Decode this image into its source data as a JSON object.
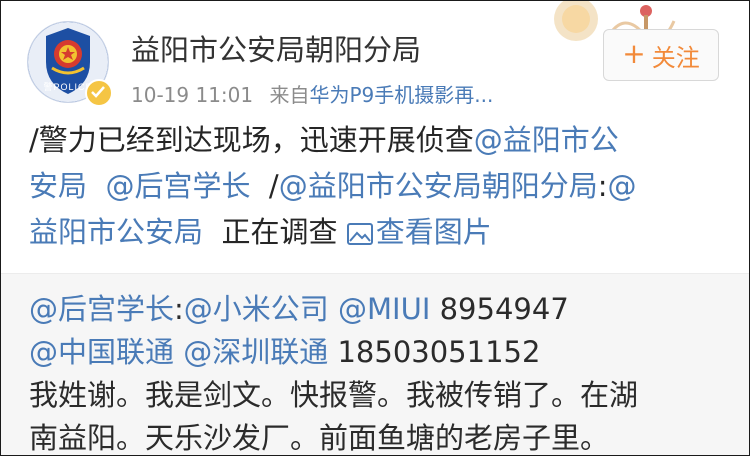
{
  "header": {
    "account_name": "益阳市公安局朝阳分局",
    "timestamp": "10-19 11:01",
    "source_prefix": "来自",
    "source_device": "华为P9手机摄影再...",
    "follow_label": "关注",
    "follow_icon": "plus-icon",
    "avatar_text": "警POLICE",
    "verified_icon": "verified-check-icon"
  },
  "post": {
    "line1_text": "/警力已经到达现场，迅速开展侦查",
    "mention1": "@益阳市公",
    "mention1_cont": "安局",
    "mention2": "@后宫学长",
    "slash2": "/",
    "mention3": "@益阳市公安局朝阳分局",
    "colon3": ":",
    "mention4a": "@",
    "mention4": "益阳市公安局",
    "tail_text": "正在调查",
    "view_images_label": "查看图片",
    "view_images_icon": "image-icon"
  },
  "retweet": {
    "author_mention": "@后宫学长",
    "colon": ":",
    "mention_xiaomi": "@小米公司",
    "mention_miui": "@MIUI",
    "number1": "8954947",
    "mention_unicom": "@中国联通",
    "mention_sz_unicom": "@深圳联通",
    "phone": "18503051152",
    "line3": "我姓谢。我是剑文。快报警。我被传销了。在湖",
    "line4": "南益阳。天乐沙发厂。前面鱼塘的老房子里。"
  },
  "colors": {
    "link": "#4a7bb7",
    "follow_accent": "#f28a3a",
    "retweet_bg": "#f6f6f6",
    "meta_gray": "#8b8b8b"
  }
}
